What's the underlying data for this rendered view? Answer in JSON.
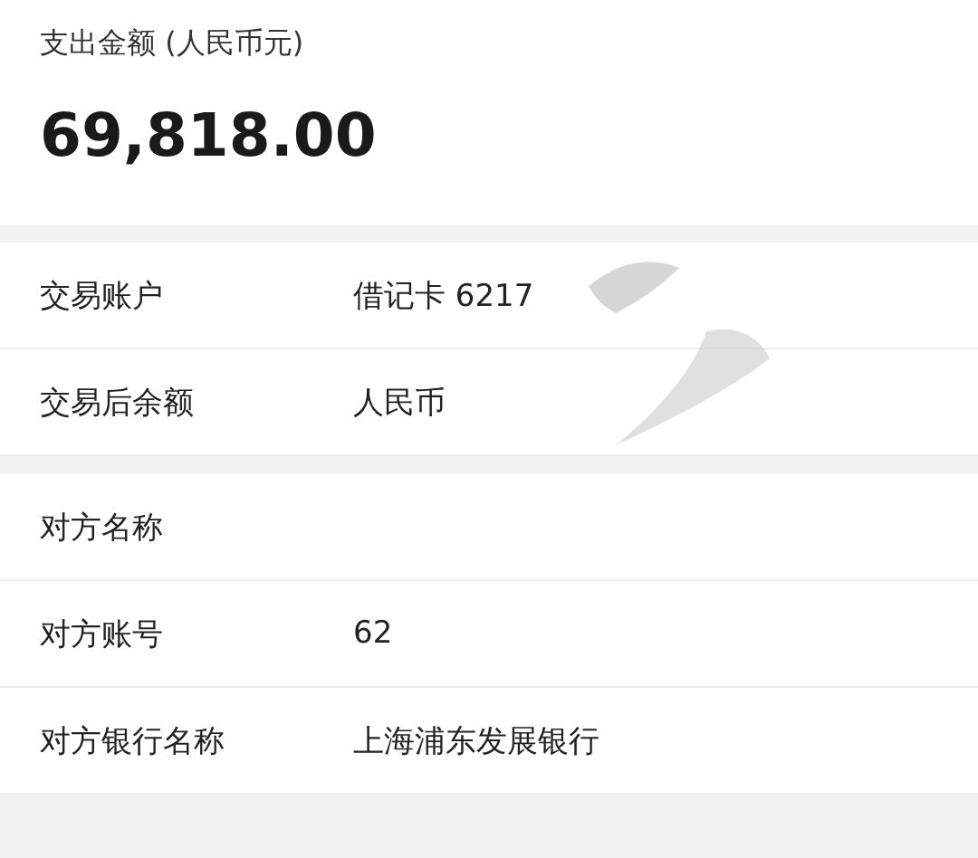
{
  "amount_label": "支出金额 (人民币元)",
  "amount": "69,818.00",
  "groups": [
    {
      "rows": [
        {
          "label": "交易账户",
          "value": "借记卡 6217"
        },
        {
          "label": "交易后余额",
          "value": "人民币"
        }
      ]
    },
    {
      "rows": [
        {
          "label": "对方名称"
        },
        {
          "label": "对方账号",
          "value": "62"
        },
        {
          "label": "对方银行名称",
          "value": "上海浦东发展银行"
        }
      ]
    }
  ]
}
